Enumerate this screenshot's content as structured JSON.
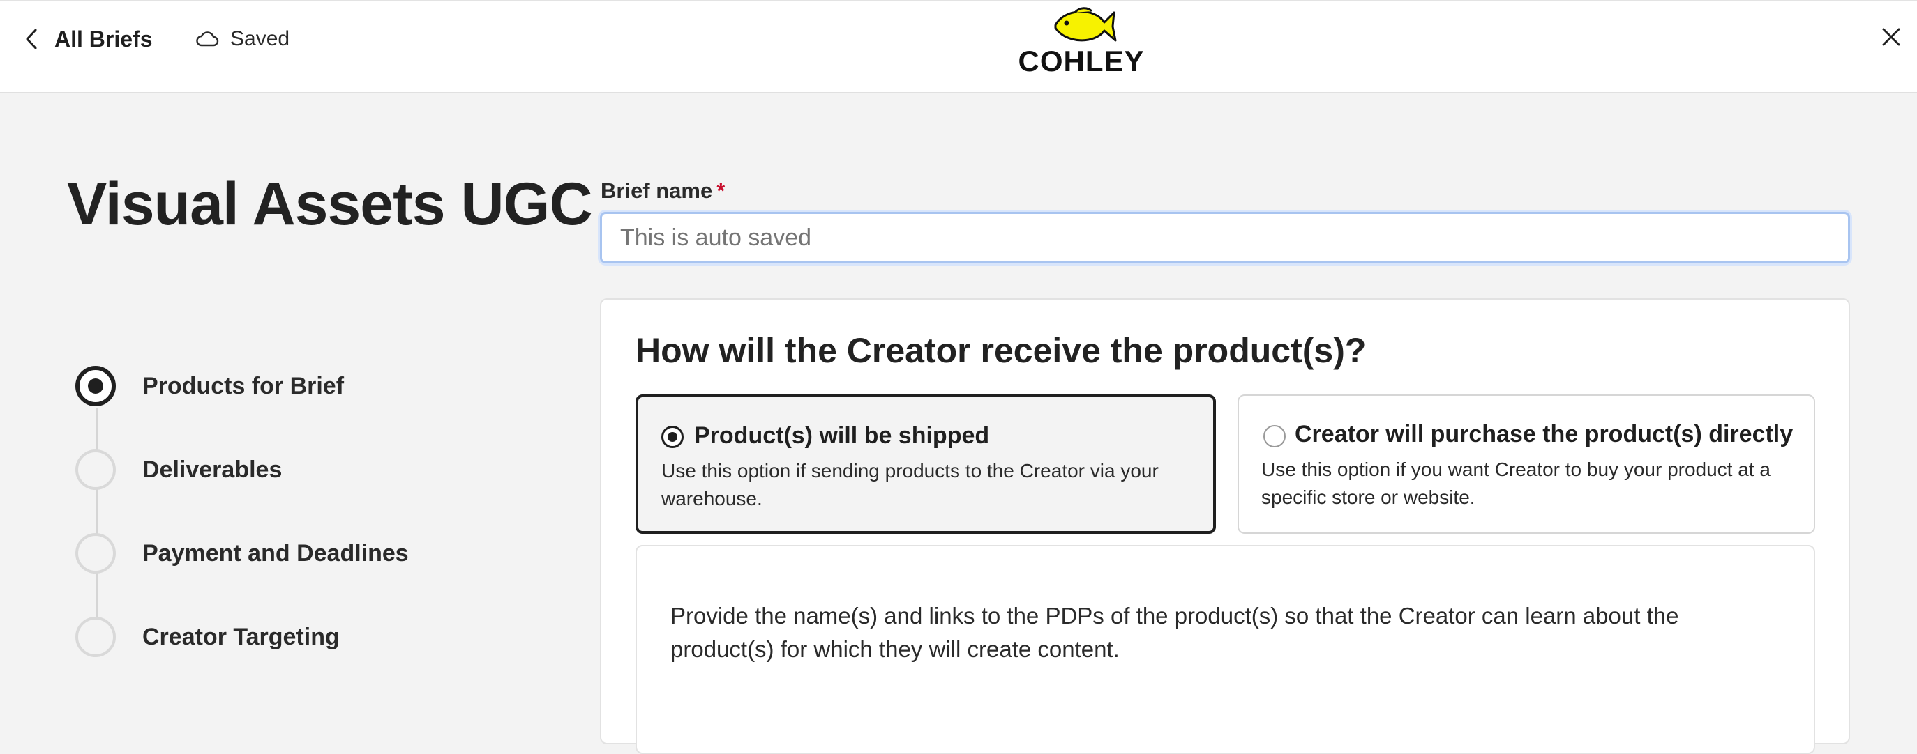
{
  "header": {
    "back_label": "All Briefs",
    "saved_label": "Saved",
    "logo_text": "COHLEY"
  },
  "page": {
    "title": "Visual Assets UGC"
  },
  "steps": [
    {
      "label": "Products for Brief",
      "active": true
    },
    {
      "label": "Deliverables",
      "active": false
    },
    {
      "label": "Payment and Deadlines",
      "active": false
    },
    {
      "label": "Creator Targeting",
      "active": false
    }
  ],
  "form": {
    "brief_name_label": "Brief name",
    "required_mark": "*",
    "brief_name_placeholder": "This is auto saved",
    "brief_name_value": ""
  },
  "delivery": {
    "question": "How will the Creator receive the product(s)?",
    "options": [
      {
        "title": "Product(s) will be shipped",
        "description": "Use this option if sending products to the Creator via your warehouse.",
        "selected": true
      },
      {
        "title": "Creator will purchase the product(s) directly",
        "description": "Use this option if you want Creator to buy your product at a specific store or website.",
        "selected": false
      }
    ],
    "instructions": "Provide the name(s) and links to the PDPs of the product(s) so that the Creator can learn about the product(s) for which they will create content."
  },
  "colors": {
    "accent_dark": "#1f1f1f",
    "required": "#c8102e",
    "logo_fish": "#f7f200",
    "input_focus": "#a8c4f0"
  },
  "icons": {
    "back": "chevron-left-icon",
    "saved": "cloud-icon",
    "close": "close-icon",
    "logo": "fish-logo"
  }
}
